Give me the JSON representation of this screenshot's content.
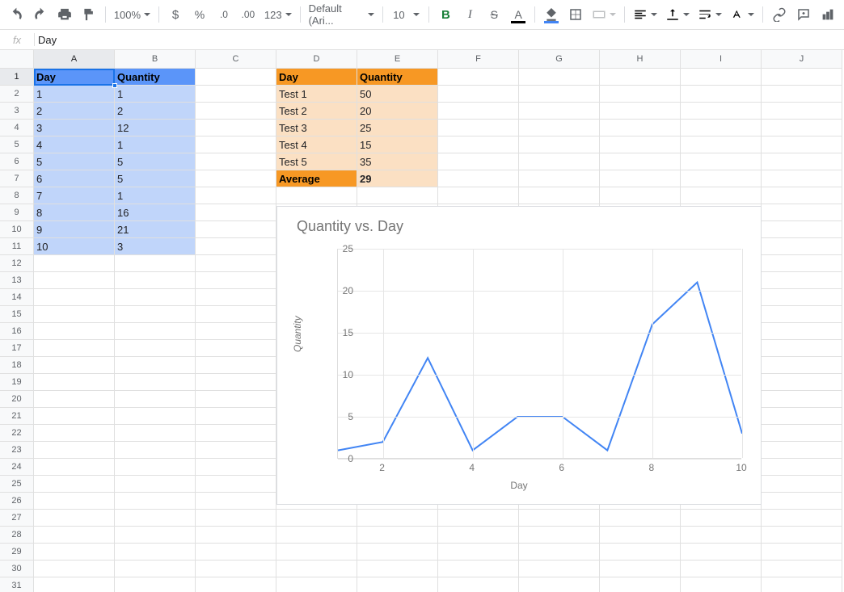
{
  "toolbar": {
    "zoom": "100%",
    "more_formats": "123",
    "font": "Default (Ari...",
    "font_size": "10"
  },
  "formula_bar": {
    "label": "fx",
    "value": "Day"
  },
  "columns": [
    "A",
    "B",
    "C",
    "D",
    "E",
    "F",
    "G",
    "H",
    "I",
    "J"
  ],
  "rows_visible": 31,
  "active_cell": {
    "col": "A",
    "row": 1
  },
  "table_blue": {
    "headers": [
      "Day",
      "Quantity"
    ],
    "rows": [
      [
        "1",
        "1"
      ],
      [
        "2",
        "2"
      ],
      [
        "3",
        "12"
      ],
      [
        "4",
        "1"
      ],
      [
        "5",
        "5"
      ],
      [
        "6",
        "5"
      ],
      [
        "7",
        "1"
      ],
      [
        "8",
        "16"
      ],
      [
        "9",
        "21"
      ],
      [
        "10",
        "3"
      ]
    ]
  },
  "table_orange": {
    "headers": [
      "Day",
      "Quantity"
    ],
    "rows": [
      [
        "Test 1",
        "50"
      ],
      [
        "Test 2",
        "20"
      ],
      [
        "Test 3",
        "25"
      ],
      [
        "Test 4",
        "15"
      ],
      [
        "Test 5",
        "35"
      ]
    ],
    "footer": [
      "Average",
      "29"
    ]
  },
  "chart_data": {
    "type": "line",
    "title": "Quantity vs. Day",
    "xlabel": "Day",
    "ylabel": "Quantity",
    "x": [
      1,
      2,
      3,
      4,
      5,
      6,
      7,
      8,
      9,
      10
    ],
    "values": [
      1,
      2,
      12,
      1,
      5,
      5,
      1,
      16,
      21,
      3
    ],
    "xlim": [
      1,
      10
    ],
    "ylim": [
      0,
      25
    ],
    "xticks": [
      2,
      4,
      6,
      8,
      10
    ],
    "yticks": [
      0,
      5,
      10,
      15,
      20,
      25
    ]
  }
}
